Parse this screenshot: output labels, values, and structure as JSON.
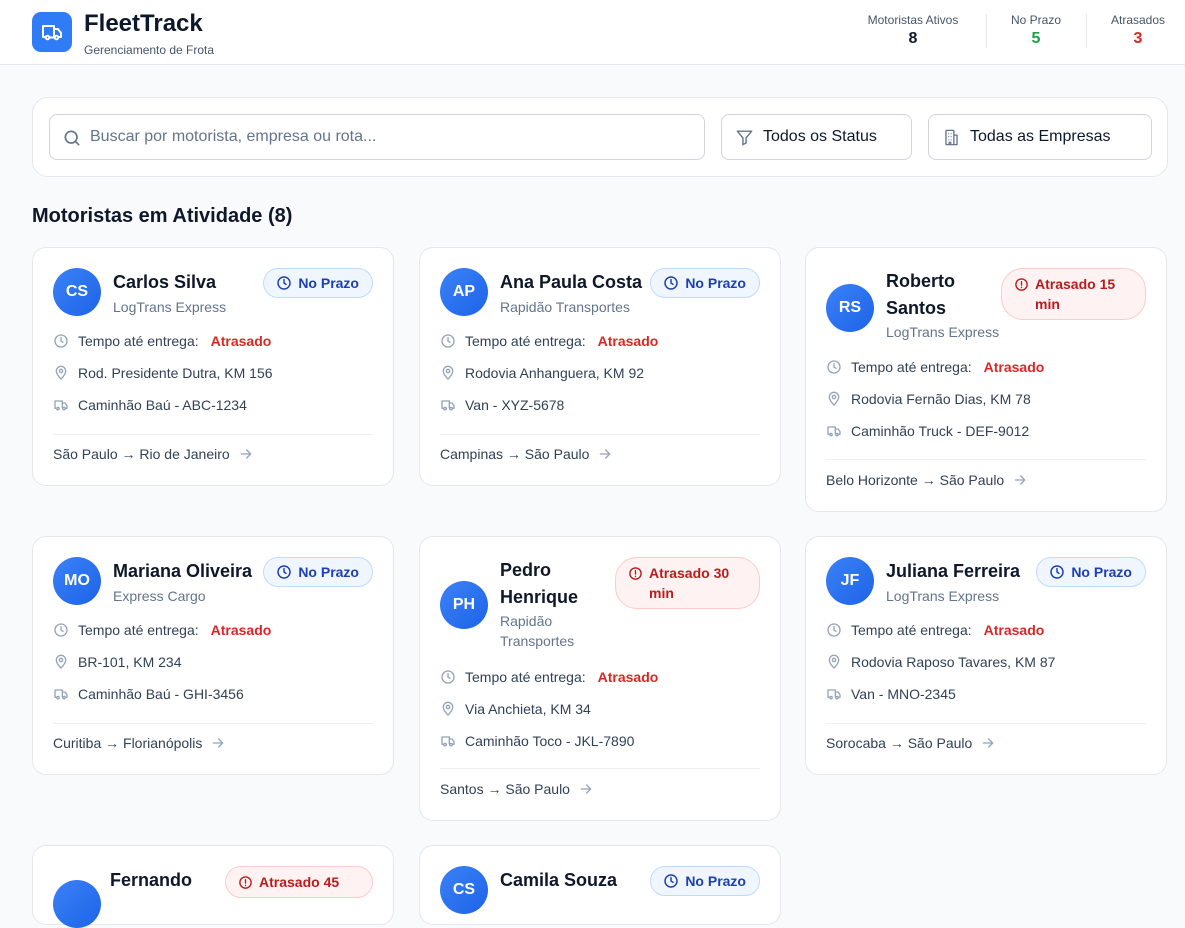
{
  "app": {
    "title": "FleetTrack",
    "subtitle": "Gerenciamento de Frota",
    "logo_icon": "truck-icon",
    "brand_color": "#2f7cf6"
  },
  "stats": [
    {
      "label": "Motoristas Ativos",
      "value": "8",
      "color": "#0f172a"
    },
    {
      "label": "No Prazo",
      "value": "5",
      "color": "#16a34a"
    },
    {
      "label": "Atrasados",
      "value": "3",
      "color": "#dc2626"
    }
  ],
  "filters": {
    "search_placeholder": "Buscar por motorista, empresa ou rota...",
    "search_value": "",
    "status_select": "Todos os Status",
    "company_select": "Todas as Empresas"
  },
  "section_title": "Motoristas em Atividade (8)",
  "labels": {
    "eta_label": "Tempo até entrega:"
  },
  "drivers": [
    {
      "initials": "CS",
      "name": "Carlos Silva",
      "company": "LogTrans Express",
      "status": "No Prazo",
      "eta": "Atrasado",
      "location": "Rod. Presidente Dutra, KM 156",
      "vehicle": "Caminhão Baú - ABC-1234",
      "route": "São Paulo → Rio de Janeiro"
    },
    {
      "initials": "AP",
      "name": "Ana Paula Costa",
      "company": "Rapidão Transportes",
      "status": "No Prazo",
      "eta": "Atrasado",
      "location": "Rodovia Anhanguera, KM 92",
      "vehicle": "Van - XYZ-5678",
      "route": "Campinas → São Paulo"
    },
    {
      "initials": "RS",
      "name": "Roberto Santos",
      "company": "LogTrans Express",
      "status": "Atrasado 15 min",
      "eta": "Atrasado",
      "location": "Rodovia Fernão Dias, KM 78",
      "vehicle": "Caminhão Truck - DEF-9012",
      "route": "Belo Horizonte → São Paulo"
    },
    {
      "initials": "MO",
      "name": "Mariana Oliveira",
      "company": "Express Cargo",
      "status": "No Prazo",
      "eta": "Atrasado",
      "location": "BR-101, KM 234",
      "vehicle": "Caminhão Baú - GHI-3456",
      "route": "Curitiba → Florianópolis"
    },
    {
      "initials": "PH",
      "name": "Pedro Henrique",
      "company": "Rapidão Transportes",
      "status": "Atrasado 30 min",
      "eta": "Atrasado",
      "location": "Via Anchieta, KM 34",
      "vehicle": "Caminhão Toco - JKL-7890",
      "route": "Santos → São Paulo"
    },
    {
      "initials": "JF",
      "name": "Juliana Ferreira",
      "company": "LogTrans Express",
      "status": "No Prazo",
      "eta": "Atrasado",
      "location": "Rodovia Raposo Tavares, KM 87",
      "vehicle": "Van - MNO-2345",
      "route": "Sorocaba → São Paulo"
    },
    {
      "initials": "",
      "name": "Fernando",
      "company": "",
      "status": "Atrasado 45",
      "eta": "",
      "location": "",
      "vehicle": "",
      "route": ""
    },
    {
      "initials": "CS",
      "name": "Camila Souza",
      "company": "",
      "status": "No Prazo",
      "eta": "",
      "location": "",
      "vehicle": "",
      "route": ""
    }
  ],
  "colors": {
    "on_time_badge_bg": "#eff6ff",
    "on_time_badge_text": "#1e40af",
    "late_badge_bg": "#fef2f2",
    "late_badge_text": "#b91c1c",
    "late_text": "#dc2626"
  }
}
